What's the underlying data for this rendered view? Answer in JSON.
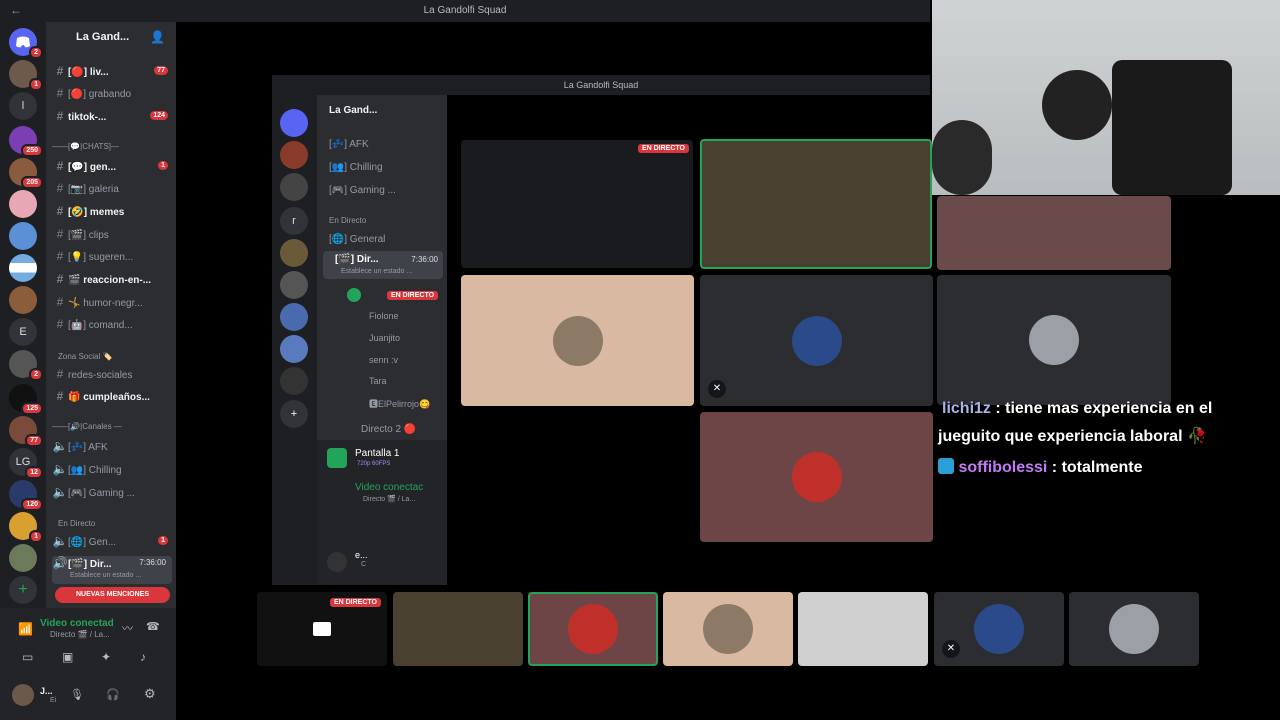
{
  "window": {
    "title": "La Gandolfi Squad",
    "back_label": "←"
  },
  "rail": {
    "servers": [
      {
        "label": "",
        "badge": "2"
      },
      {
        "label": "",
        "badge": "1"
      },
      {
        "label": "l",
        "badge": ""
      },
      {
        "label": "",
        "badge": "250"
      },
      {
        "label": "",
        "badge": "205"
      },
      {
        "label": "",
        "badge": ""
      },
      {
        "label": "",
        "badge": ""
      },
      {
        "label": "",
        "badge": ""
      },
      {
        "label": "",
        "badge": ""
      },
      {
        "label": "E",
        "badge": ""
      },
      {
        "label": "",
        "badge": "2"
      },
      {
        "label": "",
        "badge": "125"
      },
      {
        "label": "",
        "badge": "77"
      },
      {
        "label": "LG",
        "badge": "12"
      },
      {
        "label": "",
        "badge": "120"
      },
      {
        "label": "",
        "badge": "1"
      },
      {
        "label": "",
        "badge": ""
      }
    ],
    "add_label": "+"
  },
  "sidebar": {
    "server_name": "La Gand...",
    "channels": [
      {
        "name": "[🔴] liv...",
        "count": "77",
        "bright": true
      },
      {
        "name": "[🔴] grabando",
        "count": "",
        "bright": false
      },
      {
        "name": "tiktok-...",
        "count": "124",
        "bright": true
      },
      {
        "name": "——[💬|CHATS]—",
        "count": "",
        "bright": false
      },
      {
        "name": "[💬] gen...",
        "count": "1",
        "bright": true
      },
      {
        "name": "[📷] galeria",
        "count": "",
        "bright": false
      },
      {
        "name": "[🤣] memes",
        "count": "",
        "bright": true
      },
      {
        "name": "[🎬] clips",
        "count": "",
        "bright": false
      },
      {
        "name": "[💡] sugeren...",
        "count": "",
        "bright": false
      },
      {
        "name": "🎬 reaccion-en-...",
        "count": "",
        "bright": true
      },
      {
        "name": "🤸 humor-negr...",
        "count": "",
        "bright": false
      },
      {
        "name": "[🤖] comand...",
        "count": "",
        "bright": false
      }
    ],
    "zona_social": "Zona Social 🏷️",
    "social_channels": [
      {
        "name": "redes-sociales",
        "bright": false
      },
      {
        "name": "🎁 cumpleaños...",
        "bright": true
      }
    ],
    "voice_category": "——[🔊|Canales —",
    "voice_channels": [
      "[💤] AFK",
      "[👥] Chilling",
      "[🎮] Gaming ..."
    ],
    "en_directo": "En Directo",
    "directo_channels": [
      {
        "name": "[🌐] Gen...",
        "count": "1"
      },
      {
        "name": "[🎬] Dir...",
        "time": "7:36:00",
        "sub": "Establece un estado ..."
      }
    ],
    "mentions_label": "NUEVAS MENCIONES",
    "voice_status": "Video conectad",
    "voice_sub": "Directo 🎬 / La...",
    "user_name": "J...",
    "user_sub": "Ei"
  },
  "nested": {
    "title": "La Gandolfi Squad",
    "server_name": "La Gand...",
    "channels": [
      "[💤] AFK",
      "[👥] Chilling",
      "[🎮] Gaming ..."
    ],
    "en_directo": "En Directo",
    "general": "[🌐] General",
    "directo": "[🎬] Dir...",
    "directo_time": "7:36:00",
    "directo_sub": "Establece un estado ...",
    "users": [
      "Fiolone",
      "Juanjito",
      "senn :v",
      "Tara",
      "🅴ElPelirrojo😋"
    ],
    "live_label": "EN DIRECTO",
    "directo2": "Directo 2 🔴",
    "panel_title": "Pantalla 1",
    "panel_sub": "720p 60FPS",
    "voice_status": "Video conectac",
    "voice_sub": "Directo 🎬 / La...",
    "user_name": "e...",
    "user_sub": "C"
  },
  "tiles": {
    "live_label": "EN DIRECTO"
  },
  "chat": [
    {
      "user": "lichi1z",
      "text": " : tiene mas experiencia en el"
    },
    {
      "user": "",
      "text": "jueguito que experiencia laboral 🥀"
    },
    {
      "user": "soffibolessi",
      "text": " : totalmente"
    }
  ]
}
